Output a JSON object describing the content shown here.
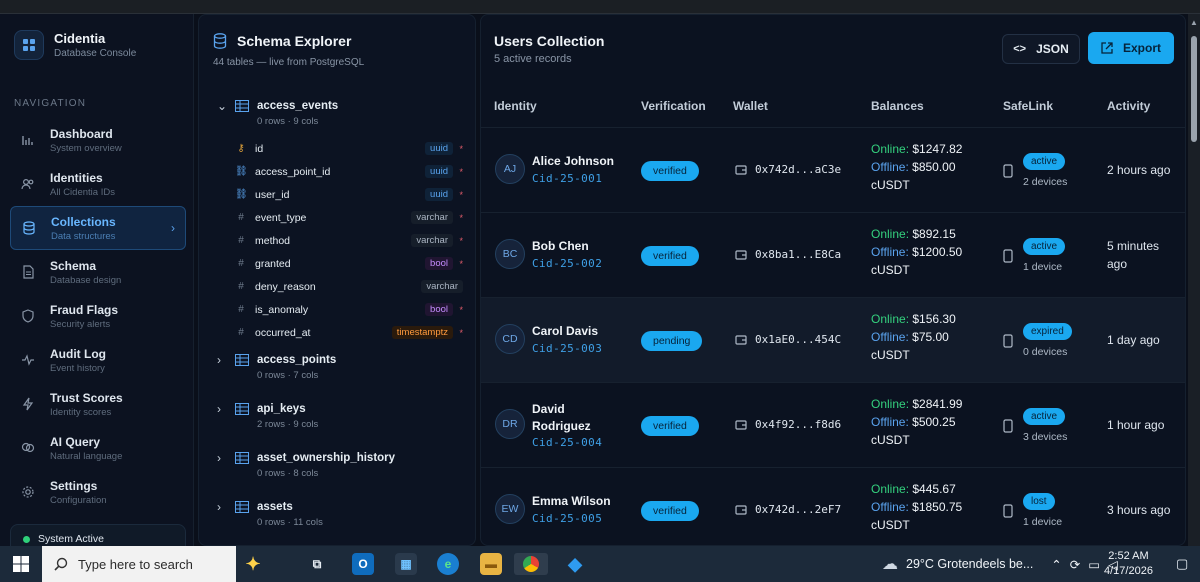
{
  "app": {
    "name": "Cidentia",
    "subtitle": "Database Console"
  },
  "nav": {
    "heading": "NAVIGATION",
    "items": [
      {
        "label": "Dashboard",
        "sub": "System overview",
        "icon": "bar-chart-icon"
      },
      {
        "label": "Identities",
        "sub": "All Cidentia IDs",
        "icon": "users-icon"
      },
      {
        "label": "Collections",
        "sub": "Data structures",
        "icon": "database-icon",
        "active": true
      },
      {
        "label": "Schema",
        "sub": "Database design",
        "icon": "document-icon"
      },
      {
        "label": "Fraud Flags",
        "sub": "Security alerts",
        "icon": "shield-icon"
      },
      {
        "label": "Audit Log",
        "sub": "Event history",
        "icon": "activity-icon"
      },
      {
        "label": "Trust Scores",
        "sub": "Identity scores",
        "icon": "zap-icon"
      },
      {
        "label": "AI Query",
        "sub": "Natural language",
        "icon": "brain-icon"
      },
      {
        "label": "Settings",
        "sub": "Configuration",
        "icon": "gear-icon"
      }
    ],
    "status": "System Active"
  },
  "schema": {
    "title": "Schema Explorer",
    "subtitle": "44 tables — live from PostgreSQL",
    "tables": [
      {
        "name": "access_events",
        "meta": "0 rows · 9 cols",
        "expanded": true
      },
      {
        "name": "access_points",
        "meta": "0 rows · 7 cols"
      },
      {
        "name": "api_keys",
        "meta": "2 rows · 9 cols"
      },
      {
        "name": "asset_ownership_history",
        "meta": "0 rows · 8 cols"
      },
      {
        "name": "assets",
        "meta": "0 rows · 11 cols"
      }
    ],
    "columns": [
      {
        "name": "id",
        "type": "uuid",
        "kind": "key"
      },
      {
        "name": "access_point_id",
        "type": "uuid",
        "kind": "link"
      },
      {
        "name": "user_id",
        "type": "uuid",
        "kind": "link"
      },
      {
        "name": "event_type",
        "type": "varchar",
        "kind": "hash"
      },
      {
        "name": "method",
        "type": "varchar",
        "kind": "hash"
      },
      {
        "name": "granted",
        "type": "bool",
        "kind": "hash"
      },
      {
        "name": "deny_reason",
        "type": "varchar",
        "kind": "hash"
      },
      {
        "name": "is_anomaly",
        "type": "bool",
        "kind": "hash"
      },
      {
        "name": "occurred_at",
        "type": "timestamptz",
        "kind": "hash"
      }
    ]
  },
  "collection": {
    "title": "Users Collection",
    "subtitle": "5 active records",
    "json_label": "JSON",
    "export_label": "Export",
    "headers": [
      "Identity",
      "Verification",
      "Wallet",
      "Balances",
      "SafeLink",
      "Activity"
    ],
    "online_label": "Online:",
    "offline_label": "Offline:",
    "currency": "cUSDT",
    "rows": [
      {
        "initials": "AJ",
        "name": "Alice Johnson",
        "id": "Cid-25-001",
        "verification": "verified",
        "wallet": "0x742d...aC3e",
        "online": "$1247.82",
        "offline": "$850.00",
        "safelink": "active",
        "devices": "2 devices",
        "activity": "2 hours ago"
      },
      {
        "initials": "BC",
        "name": "Bob Chen",
        "id": "Cid-25-002",
        "verification": "verified",
        "wallet": "0x8ba1...E8Ca",
        "online": "$892.15",
        "offline": "$1200.50",
        "safelink": "active",
        "devices": "1 device",
        "activity": "5 minutes ago"
      },
      {
        "initials": "CD",
        "name": "Carol Davis",
        "id": "Cid-25-003",
        "verification": "pending",
        "wallet": "0x1aE0...454C",
        "online": "$156.30",
        "offline": "$75.00",
        "safelink": "expired",
        "devices": "0 devices",
        "activity": "1 day ago"
      },
      {
        "initials": "DR",
        "name": "David Rodriguez",
        "id": "Cid-25-004",
        "verification": "verified",
        "wallet": "0x4f92...f8d6",
        "online": "$2841.99",
        "offline": "$500.25",
        "safelink": "active",
        "devices": "3 devices",
        "activity": "1 hour ago"
      },
      {
        "initials": "EW",
        "name": "Emma Wilson",
        "id": "Cid-25-005",
        "verification": "verified",
        "wallet": "0x742d...2eF7",
        "online": "$445.67",
        "offline": "$1850.75",
        "safelink": "lost",
        "devices": "1 device",
        "activity": "3 hours ago"
      }
    ]
  },
  "taskbar": {
    "search_placeholder": "Type here to search",
    "weather": "29°C  Grotendeels be...",
    "time": "2:52 AM",
    "date": "4/17/2026"
  },
  "colors": {
    "accent": "#1aa8f0",
    "online": "#34d17e",
    "offline": "#5aa3ee",
    "bg": "#0a0f1a"
  }
}
